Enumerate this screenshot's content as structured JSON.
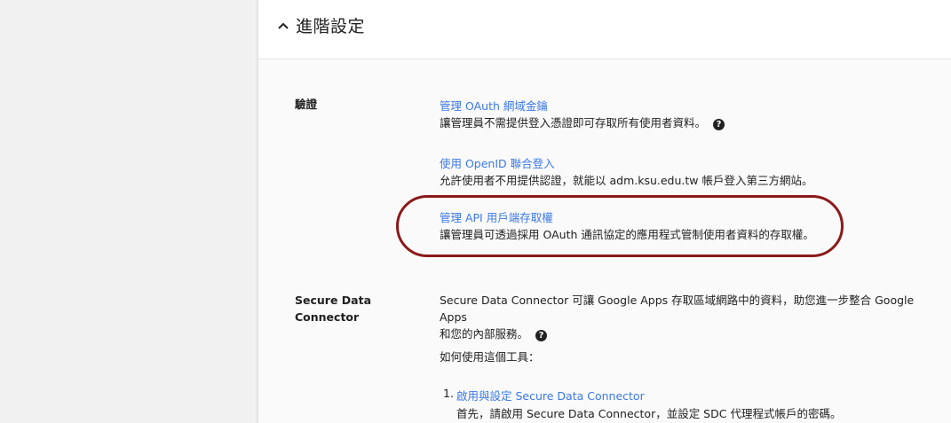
{
  "section": {
    "title": "進階設定"
  },
  "auth": {
    "label": "驗證",
    "items": [
      {
        "link": "管理 OAuth 網域金鑰",
        "desc": "讓管理員不需提供登入憑證即可存取所有使用者資料。"
      },
      {
        "link": "使用 OpenID 聯合登入",
        "desc": "允許使用者不用提供認證，就能以 adm.ksu.edu.tw 帳戶登入第三方網站。"
      },
      {
        "link": "管理 API 用戶端存取權",
        "desc": "讓管理員可透過採用 OAuth 通訊協定的應用程式管制使用者資料的存取權。"
      }
    ],
    "help_glyph": "?"
  },
  "sdc": {
    "label_line1": "Secure Data",
    "label_line2": "Connector",
    "desc_line1": "Secure Data Connector 可讓 Google Apps 存取區域網路中的資料，助您進一步整合 Google Apps",
    "desc_line2": "和您的內部服務。",
    "help_glyph": "?",
    "howto": "如何使用這個工具：",
    "steps": [
      {
        "num": "1.",
        "link": "啟用與設定 Secure Data Connector",
        "desc": "首先，請啟用 Secure Data Connector，並設定 SDC 代理程式帳戶的密碼。"
      }
    ]
  },
  "icons": {
    "collapse": "chevron-up-icon",
    "help": "help-circle-icon"
  },
  "colors": {
    "link": "#3b78e7",
    "highlight": "#8b1a1a"
  }
}
